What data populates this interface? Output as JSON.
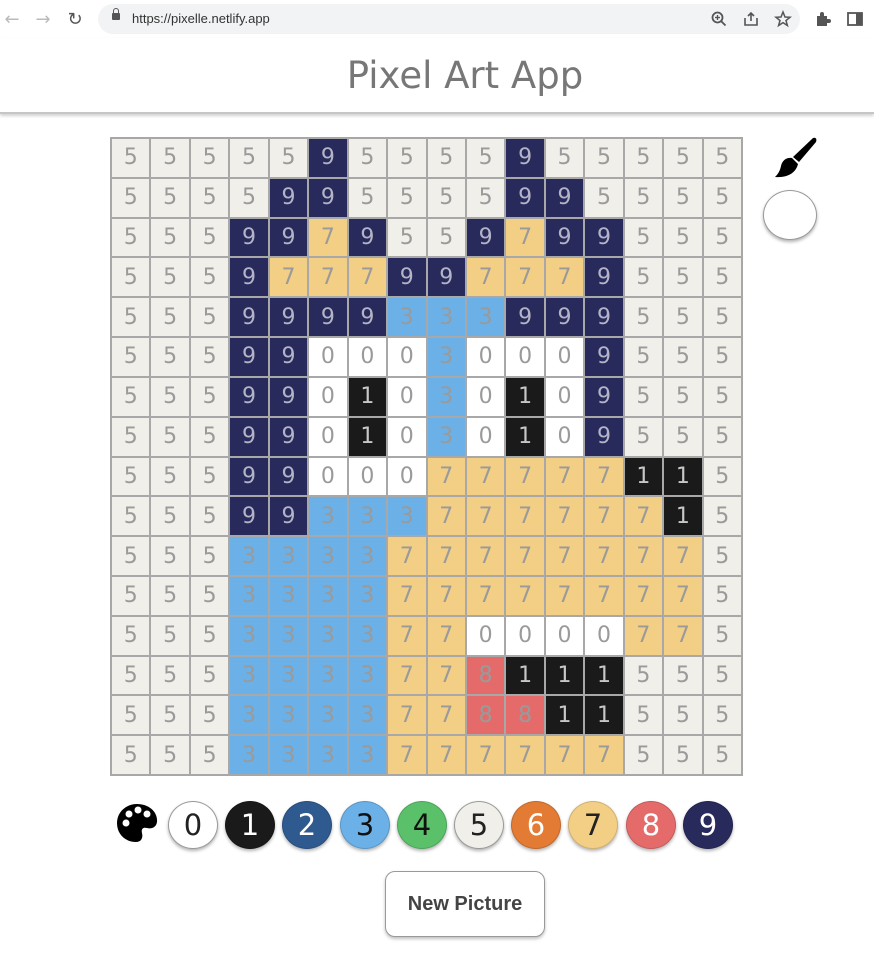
{
  "browser": {
    "url": "https://pixelle.netlify.app",
    "icons": [
      "back-arrow-icon",
      "forward-arrow-icon",
      "reload-icon",
      "lock-icon",
      "zoom-icon",
      "share-icon",
      "bookmark-star-icon",
      "extensions-puzzle-icon",
      "side-panel-icon"
    ]
  },
  "app": {
    "title": "Pixel Art App"
  },
  "palette": {
    "icon": "palette-icon",
    "colors": [
      {
        "label": "0",
        "color": "#ffffff",
        "text": "#222222"
      },
      {
        "label": "1",
        "color": "#1a1a1a",
        "text": "#ffffff"
      },
      {
        "label": "2",
        "color": "#2f5a8f",
        "text": "#ffffff"
      },
      {
        "label": "3",
        "color": "#6bb0e6",
        "text": "#111111"
      },
      {
        "label": "4",
        "color": "#5bc06a",
        "text": "#111111"
      },
      {
        "label": "5",
        "color": "#f0efe9",
        "text": "#222222"
      },
      {
        "label": "6",
        "color": "#e37b34",
        "text": "#ffffff"
      },
      {
        "label": "7",
        "color": "#f2cf85",
        "text": "#222222"
      },
      {
        "label": "8",
        "color": "#e56b6b",
        "text": "#ffffff"
      },
      {
        "label": "9",
        "color": "#282a5c",
        "text": "#ffffff"
      }
    ]
  },
  "tools": {
    "brush_icon": "paintbrush-icon",
    "current_color": "#ffffff"
  },
  "grid": [
    "5555595555955555",
    "5555995555995555",
    "5559979559799555",
    "5559777997779555",
    "5559999333999555",
    "5559900030009555",
    "5559901030109555",
    "5559901030109555",
    "5559900077777115",
    "5559933377777715",
    "5553333777777775",
    "5553333777777775",
    "5553333770000775",
    "5553333778111555",
    "5553333778811555",
    "5553333777777555"
  ],
  "actions": {
    "new_picture": "New Picture"
  }
}
